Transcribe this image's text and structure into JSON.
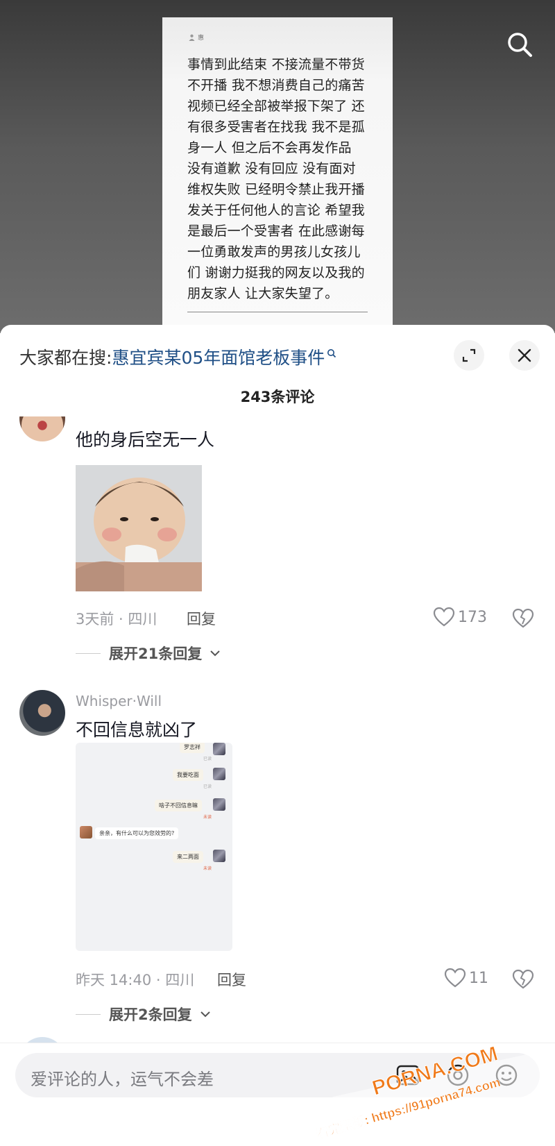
{
  "video": {
    "note_user": "惠",
    "note_text": "事情到此结束 不接流量不带货不开播 我不想消费自己的痛苦 视频已经全部被举报下架了 还有很多受害者在找我 我不是孤身一人 但之后不会再发作品 没有道歉 没有回应 没有面对 维权失败 已经明令禁止我开播 发关于任何他人的言论 希望我是最后一个受害者 在此感谢每一位勇敢发声的男孩儿女孩儿们 谢谢力挺我的网友以及我的朋友家人 让大家失望了。"
  },
  "sheet": {
    "hot_search_prefix": "大家都在搜:",
    "hot_search_query": "惠宜宾某05年面馆老板事件",
    "comment_count": "243条评论"
  },
  "comments": [
    {
      "text": "他的身后空无一人",
      "meta": "3天前 · 四川",
      "reply": "回复",
      "likes": "173",
      "expand": "展开21条回复"
    },
    {
      "user": "Whisper·Will",
      "text": "不回信息就凶了",
      "meta": "昨天 14:40 · 四川",
      "reply": "回复",
      "likes": "11",
      "expand": "展开2条回复"
    }
  ],
  "chat_screenshot": {
    "msg1": "罗志祥",
    "msg2": "我要吃面",
    "msg3": "啥子不回信息嘛",
    "msg4": "亲亲，有什么可以为您效劳的?",
    "msg5": "来二两面",
    "tag_read": "已读",
    "tag_unread": "未读"
  },
  "bottom": {
    "input_placeholder": "爱评论的人，运气不会差"
  },
  "watermark": {
    "brand": "PORNA.COM",
    "line": "看完整版: https://91porna74.com"
  },
  "colors": {
    "link_blue": "#1f4f86",
    "watermark_orange": "#f07a1a"
  }
}
